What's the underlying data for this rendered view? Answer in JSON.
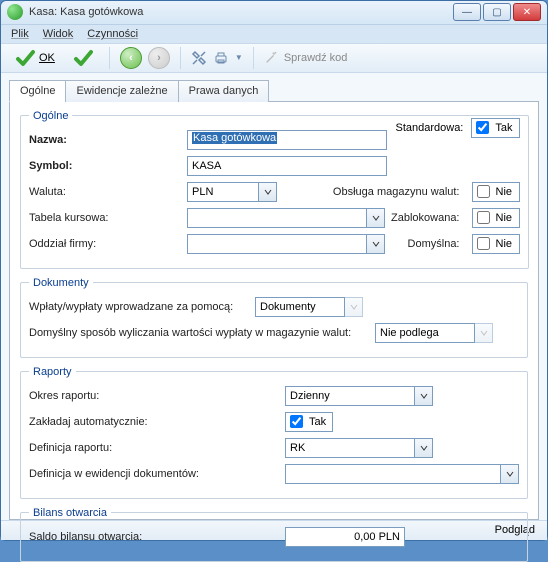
{
  "window": {
    "title": "Kasa: Kasa gotówkowa"
  },
  "menu": {
    "plik": "Plik",
    "widok": "Widok",
    "czynnosci": "Czynności"
  },
  "toolbar": {
    "ok": "OK",
    "sprawdz": "Sprawdź kod"
  },
  "tabs": {
    "ogolne": "Ogólne",
    "ewidencje": "Ewidencje zależne",
    "prawa": "Prawa danych"
  },
  "group_ogolne": {
    "legend": "Ogólne",
    "standardowa_label": "Standardowa:",
    "standardowa_value": "Tak",
    "nazwa_label": "Nazwa:",
    "nazwa_value": "Kasa gotówkowa",
    "symbol_label": "Symbol:",
    "symbol_value": "KASA",
    "waluta_label": "Waluta:",
    "waluta_value": "PLN",
    "obsluga_label": "Obsługa magazynu walut:",
    "obsluga_value": "Nie",
    "tabela_label": "Tabela kursowa:",
    "tabela_value": "",
    "zablokowana_label": "Zablokowana:",
    "zablokowana_value": "Nie",
    "oddzial_label": "Oddział firmy:",
    "oddzial_value": "",
    "domyslna_label": "Domyślna:",
    "domyslna_value": "Nie"
  },
  "group_dokumenty": {
    "legend": "Dokumenty",
    "wplaty_label": "Wpłaty/wypłaty wprowadzane za pomocą:",
    "wplaty_value": "Dokumenty",
    "domyslny_label": "Domyślny sposób wyliczania wartości wypłaty w magazynie walut:",
    "domyslny_value": "Nie podlega"
  },
  "group_raporty": {
    "legend": "Raporty",
    "okres_label": "Okres raportu:",
    "okres_value": "Dzienny",
    "zakladaj_label": "Zakładaj automatycznie:",
    "zakladaj_value": "Tak",
    "defrap_label": "Definicja raportu:",
    "defrap_value": "RK",
    "defew_label": "Definicja w ewidencji dokumentów:",
    "defew_value": ""
  },
  "group_bilans": {
    "legend": "Bilans otwarcia",
    "saldo_label": "Saldo bilansu otwarcia:",
    "saldo_value": "0,00 PLN"
  },
  "footer": {
    "podglad": "Podgląd"
  }
}
